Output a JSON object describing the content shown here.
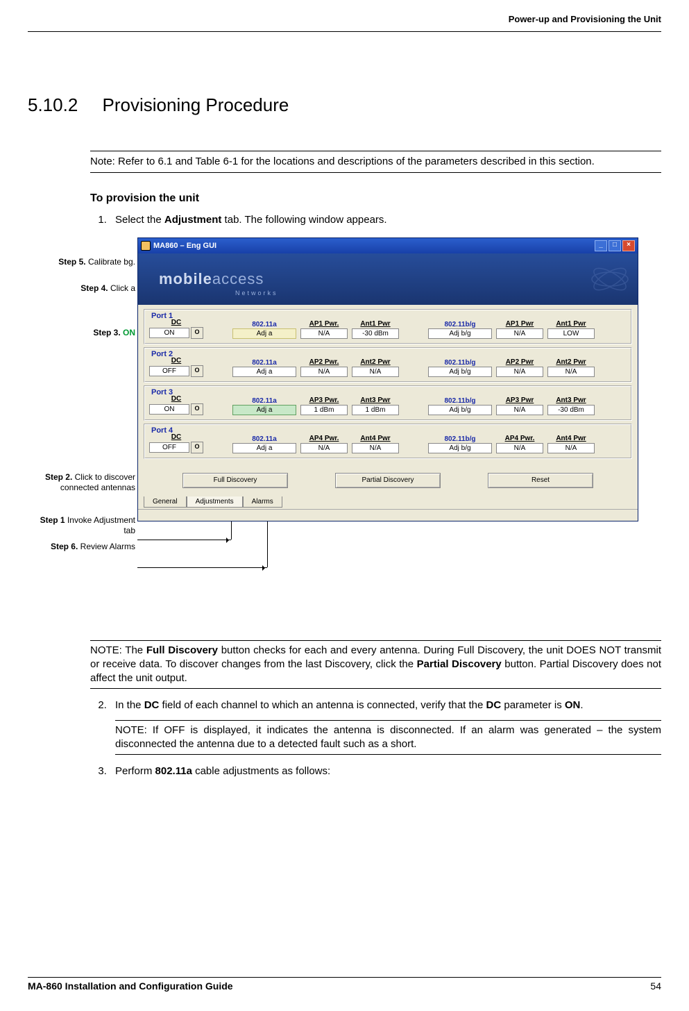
{
  "header": "Power-up and Provisioning the Unit",
  "section": {
    "number": "5.10.2",
    "title": "Provisioning Procedure"
  },
  "note1": "Note: Refer to 6.1 and Table 6-1 for the locations and descriptions of the parameters described in this section.",
  "subheading": "To provision the unit",
  "step1": {
    "prefix": "Select the ",
    "bold": "Adjustment",
    "suffix": " tab. The following window appears."
  },
  "callouts": {
    "step5_b": "Step 5.",
    "step5_t": "Calibrate bg.",
    "step4_b": "Step 4.",
    "step4_t": " Click a",
    "step3_b": "Step 3. ",
    "step3_g": "ON",
    "step2_b": "Step 2.",
    "step2_t": " Click to discover connected antennas",
    "step1b_b": "Step 1",
    "step1b_t": " Invoke Adjustment tab",
    "step6_b": "Step 6.",
    "step6_t": " Review Alarms"
  },
  "window": {
    "title": "MA860 – Eng GUI",
    "banner_mobile": "mobile",
    "banner_access": "access",
    "banner_sub": "Networks",
    "ports": [
      {
        "legend": "Port 1",
        "dc": "ON",
        "adj_a": "Adj a",
        "ap_pwr_a_lbl": "AP1 Pwr.",
        "ap_pwr_a": "N/A",
        "ant_pwr_a_lbl": "Ant1 Pwr",
        "ant_pwr_a": "-30 dBm",
        "adj_bg": "Adj b/g",
        "ap_pwr_b_lbl": "AP1 Pwr",
        "ap_pwr_b": "N/A",
        "ant_pwr_b_lbl": "Ant1 Pwr",
        "ant_pwr_b": "LOW",
        "highlight": "yellow"
      },
      {
        "legend": "Port 2",
        "dc": "OFF",
        "adj_a": "Adj a",
        "ap_pwr_a_lbl": "AP2 Pwr.",
        "ap_pwr_a": "N/A",
        "ant_pwr_a_lbl": "Ant2 Pwr",
        "ant_pwr_a": "N/A",
        "adj_bg": "Adj b/g",
        "ap_pwr_b_lbl": "AP2 Pwr",
        "ap_pwr_b": "N/A",
        "ant_pwr_b_lbl": "Ant2 Pwr",
        "ant_pwr_b": "N/A",
        "highlight": ""
      },
      {
        "legend": "Port 3",
        "dc": "ON",
        "adj_a": "Adj a",
        "ap_pwr_a_lbl": "AP3 Pwr.",
        "ap_pwr_a": "1 dBm",
        "ant_pwr_a_lbl": "Ant3 Pwr",
        "ant_pwr_a": "1 dBm",
        "adj_bg": "Adj b/g",
        "ap_pwr_b_lbl": "AP3 Pwr",
        "ap_pwr_b": "N/A",
        "ant_pwr_b_lbl": "Ant3 Pwr",
        "ant_pwr_b": "-30 dBm",
        "highlight": "green"
      },
      {
        "legend": "Port 4",
        "dc": "OFF",
        "adj_a": "Adj a",
        "ap_pwr_a_lbl": "AP4 Pwr.",
        "ap_pwr_a": "N/A",
        "ant_pwr_a_lbl": "Ant4 Pwr",
        "ant_pwr_a": "N/A",
        "adj_bg": "Adj b/g",
        "ap_pwr_b_lbl": "AP4 Pwr.",
        "ap_pwr_b": "N/A",
        "ant_pwr_b_lbl": "Ant4 Pwr",
        "ant_pwr_b": "N/A",
        "highlight": ""
      }
    ],
    "proto_a": "802.11a",
    "proto_b": "802.11b/g",
    "dc_label": "DC",
    "buttons": {
      "full": "Full Discovery",
      "partial": "Partial Discovery",
      "reset": "Reset"
    },
    "tabs": {
      "general": "General",
      "adjustments": "Adjustments",
      "alarms": "Alarms"
    }
  },
  "note2_pre": "NOTE: The ",
  "note2_b1": "Full Discovery",
  "note2_mid": " button checks for each and every antenna. During Full Discovery, the unit DOES NOT transmit or receive data. To discover changes from the last Discovery, click the ",
  "note2_b2": "Partial Discovery",
  "note2_post": " button. Partial Discovery does not affect the unit output.",
  "step2_pre": "In the ",
  "step2_b1": "DC",
  "step2_mid": " field of each channel to which an antenna is connected, verify that the ",
  "step2_b2": "DC",
  "step2_mid2": " parameter is ",
  "step2_b3": "ON",
  "step2_post": ".",
  "note3": "NOTE: If OFF is displayed, it indicates the antenna is disconnected. If an alarm was generated – the system disconnected the antenna due to a detected fault such as a short.",
  "step3_pre": "Perform ",
  "step3_b": "802.11a",
  "step3_post": " cable adjustments as follows:",
  "footer": {
    "left": "MA-860 Installation and Configuration Guide",
    "right": "54"
  }
}
